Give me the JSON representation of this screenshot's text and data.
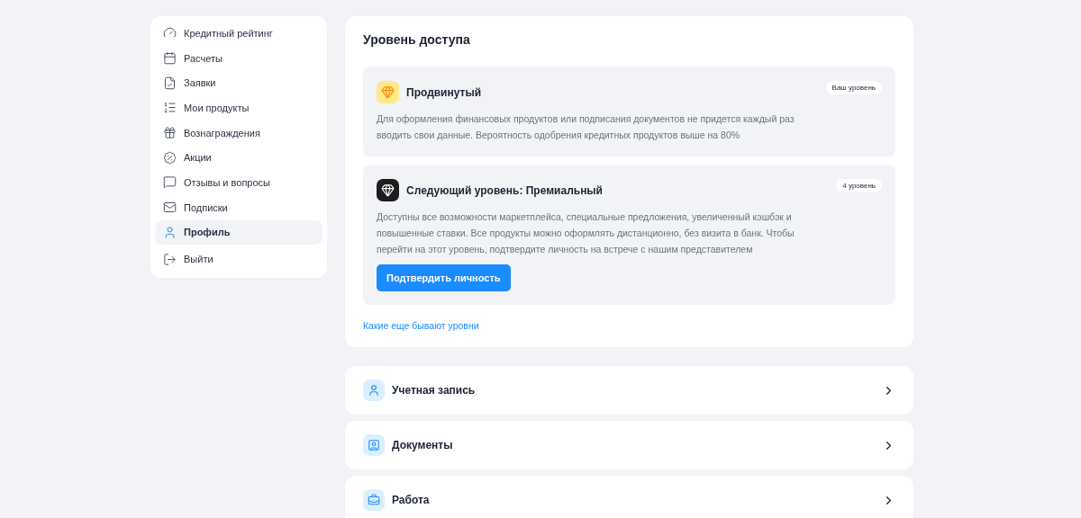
{
  "sidebar": {
    "items": [
      {
        "label": "Кредитный рейтинг",
        "selected": false
      },
      {
        "label": "Расчеты",
        "selected": false
      },
      {
        "label": "Заявки",
        "selected": false
      },
      {
        "label": "Мои продукты",
        "selected": false
      },
      {
        "label": "Вознаграждения",
        "selected": false
      },
      {
        "label": "Акции",
        "selected": false
      },
      {
        "label": "Отзывы и вопросы",
        "selected": false
      },
      {
        "label": "Подписки",
        "selected": false
      },
      {
        "label": "Профиль",
        "selected": true
      },
      {
        "label": "Выйти",
        "selected": false
      }
    ]
  },
  "access": {
    "title": "Уровень доступа",
    "levels": [
      {
        "kind": "current",
        "name": "Продвинутый",
        "badge": "Ваш уровень",
        "description": "Для оформления финансовых продуктов или подписания документов не придется каждый раз вводить свои данные. Вероятность одобрения кредитных продуктов выше на 80%"
      },
      {
        "kind": "next",
        "name": "Следующий уровень: Премиальный",
        "badge": "4 уровень",
        "description": "Доступны все возможности маркетплейса, специальные предложения, увеличенный кэшбэк и повышенные ставки. Все продукты можно оформлять дистанционно, без визита в банк. Чтобы перейти на этот уровень, подтвердите личность на встрече с нашим представителем",
        "button": "Подтвердить личность"
      }
    ],
    "link": "Какие еще бывают уровни"
  },
  "sections": [
    {
      "label": "Учетная запись"
    },
    {
      "label": "Документы"
    },
    {
      "label": "Работа"
    }
  ]
}
